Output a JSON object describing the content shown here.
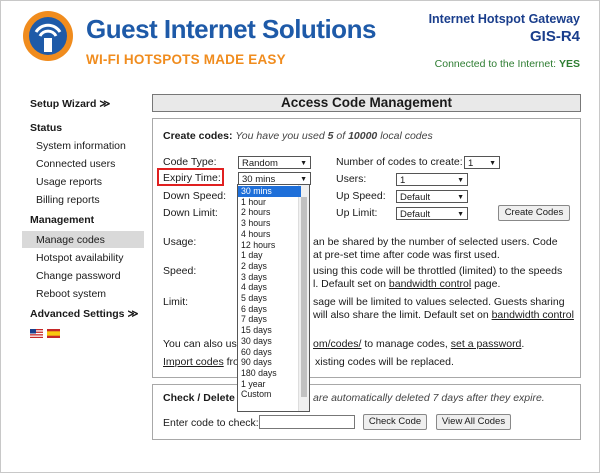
{
  "header": {
    "brand": "Guest Internet Solutions",
    "tagline": "WI-FI HOTSPOTS MADE EASY",
    "gateway_title": "Internet Hotspot Gateway",
    "gateway_model": "GIS-R4",
    "connected_label": "Connected to the Internet:",
    "connected_value": "YES"
  },
  "sidebar": {
    "setup_wizard": "Setup Wizard ≫",
    "status_head": "Status",
    "status_items": [
      "System information",
      "Connected users",
      "Usage reports",
      "Billing reports"
    ],
    "management_head": "Management",
    "management_items": [
      "Manage codes",
      "Hotspot availability",
      "Change password",
      "Reboot system"
    ],
    "advanced": "Advanced Settings ≫"
  },
  "page": {
    "title": "Access Code Management"
  },
  "create": {
    "label": "Create codes:",
    "usage_prefix": "You have you used",
    "used": "5",
    "of": "of",
    "total": "10000",
    "usage_suffix": "local codes",
    "code_type_label": "Code Type:",
    "code_type_value": "Random",
    "expiry_label": "Expiry Time:",
    "expiry_value": "30 mins",
    "down_speed_label": "Down Speed:",
    "down_limit_label": "Down Limit:",
    "num_codes_label": "Number of codes to create:",
    "num_codes_value": "1",
    "users_label": "Users:",
    "users_value": "1",
    "up_speed_label": "Up Speed:",
    "up_speed_value": "Default",
    "up_limit_label": "Up Limit:",
    "up_limit_value": "Default",
    "create_button": "Create Codes"
  },
  "help": {
    "usage_label": "Usage:",
    "usage_text_1": "an be shared by the number of selected users. Code",
    "usage_text_2": "at pre-set time after code was first used.",
    "speed_label": "Speed:",
    "speed_text_1": "using this code will be throttled (limited) to the speeds",
    "speed_text_2": "l. Default set on",
    "speed_link": "bandwidth control",
    "speed_text_3": "page.",
    "limit_label": "Limit:",
    "limit_text_1": "sage will be limited to values selected. Guests sharing",
    "limit_text_2": "will also share the limit. Default set on",
    "limit_link": "bandwidth control",
    "also_prefix": "You can also use",
    "also_link": "om/codes/",
    "also_mid": "to manage codes,",
    "also_link2": "set a password",
    "import_link": "Import codes",
    "import_text": "fro",
    "import_tail": "xisting codes will be replaced."
  },
  "check": {
    "heading": "Check / Delete C",
    "note": "are automatically deleted 7 days after they expire.",
    "input_label": "Enter code to check:",
    "input_value": "",
    "check_button": "Check Code",
    "view_all_button": "View All Codes"
  },
  "expiry_dropdown": {
    "options": [
      "30 mins",
      "1 hour",
      "2 hours",
      "3 hours",
      "4 hours",
      "12 hours",
      "1 day",
      "2 days",
      "3 days",
      "4 days",
      "5 days",
      "6 days",
      "7 days",
      "15 days",
      "30 days",
      "60 days",
      "90 days",
      "180 days",
      "1 year",
      "Custom"
    ],
    "selected": "30 mins"
  }
}
